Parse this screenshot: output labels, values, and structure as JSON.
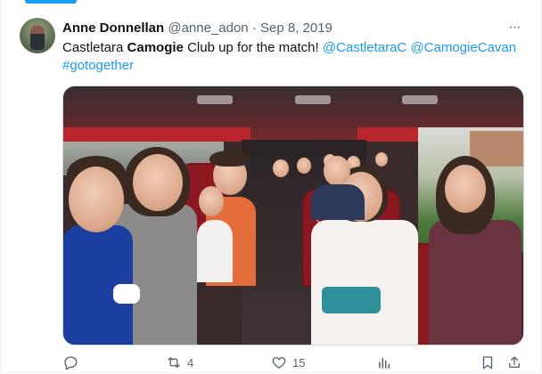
{
  "author": {
    "name": "Anne Donnellan",
    "handle": "@anne_adon",
    "separator": "·",
    "date": "Sep 8, 2019"
  },
  "tweet": {
    "text_1": "Castletara ",
    "bold": "Camogie",
    "text_2": " Club up for the match! ",
    "mention_1": "@CastletaraC",
    "space": " ",
    "mention_2": "@CamogieCavan",
    "hashtag": "#gotogether"
  },
  "actions": {
    "reply": {
      "icon": "reply-icon"
    },
    "retweet": {
      "icon": "retweet-icon",
      "count": "4"
    },
    "like": {
      "icon": "heart-icon",
      "count": "15"
    },
    "views": {
      "icon": "views-icon"
    },
    "bookmark": {
      "icon": "bookmark-icon"
    },
    "share": {
      "icon": "share-icon"
    }
  },
  "more": {
    "icon": "more-icon",
    "glyph": "···"
  },
  "colors": {
    "accent": "#1d9bf0",
    "text": "#0f1419",
    "secondary": "#536471",
    "border": "#cfd9de"
  },
  "media": {
    "type": "photo"
  }
}
